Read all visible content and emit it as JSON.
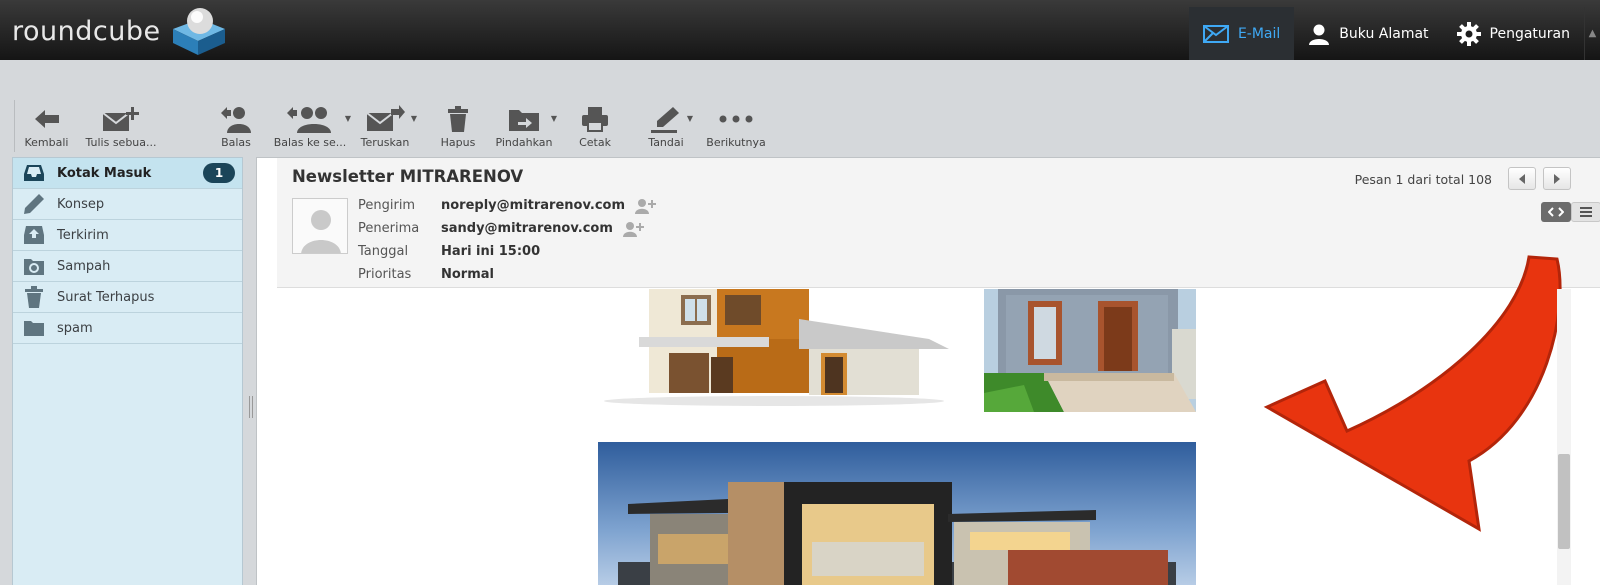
{
  "app": {
    "logo_text": "roundcube"
  },
  "topnav": {
    "items": [
      {
        "label": "E-Mail",
        "icon": "envelope-icon",
        "active": true
      },
      {
        "label": "Buku Alamat",
        "icon": "person-icon",
        "active": false
      },
      {
        "label": "Pengaturan",
        "icon": "gear-icon",
        "active": false
      }
    ]
  },
  "toolbar": {
    "back": "Kembali",
    "compose": "Tulis sebua...",
    "reply": "Balas",
    "reply_all": "Balas ke se...",
    "forward": "Teruskan",
    "delete": "Hapus",
    "move": "Pindahkan",
    "print": "Cetak",
    "mark": "Tandai",
    "more": "Berikutnya"
  },
  "folders": [
    {
      "label": "Kotak Masuk",
      "icon": "inbox-icon",
      "unread": "1",
      "selected": true
    },
    {
      "label": "Konsep",
      "icon": "pencil-icon"
    },
    {
      "label": "Terkirim",
      "icon": "sent-icon"
    },
    {
      "label": "Sampah",
      "icon": "junk-icon"
    },
    {
      "label": "Surat Terhapus",
      "icon": "trash-icon"
    },
    {
      "label": "spam",
      "icon": "folder-icon"
    }
  ],
  "message": {
    "subject": "Newsletter MITRARENOV",
    "counter": "Pesan 1 dari total 108",
    "headers": {
      "from_label": "Pengirim",
      "from": "noreply@mitrarenov.com",
      "to_label": "Penerima",
      "to": "sandy@mitrarenov.com",
      "date_label": "Tanggal",
      "date": "Hari ini 15:00",
      "priority_label": "Prioritas",
      "priority": "Normal"
    }
  },
  "colors": {
    "accent": "#3fa9f5",
    "badge": "#1b4559",
    "arrow": "#e8340f"
  }
}
